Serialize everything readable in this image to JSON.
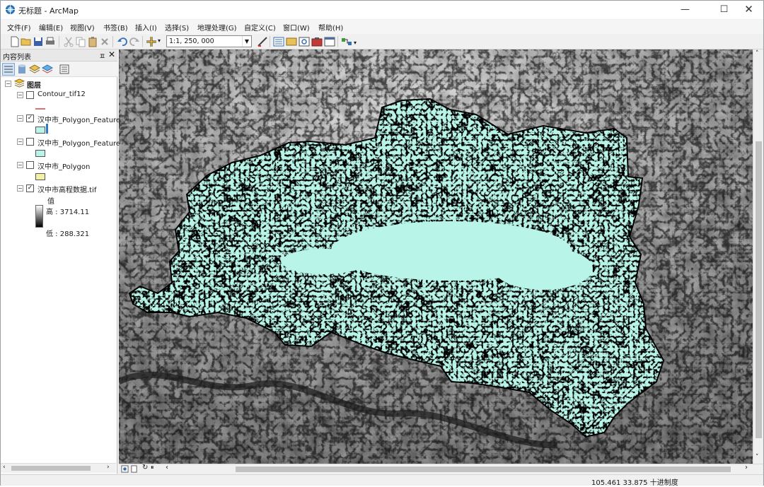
{
  "window": {
    "title": "无标题 - ArcMap",
    "minimize": "—",
    "maximize": "☐",
    "close": "✕"
  },
  "menu": {
    "items": [
      "文件(F)",
      "编辑(E)",
      "视图(V)",
      "书签(B)",
      "插入(I)",
      "选择(S)",
      "地理处理(G)",
      "自定义(C)",
      "窗口(W)",
      "帮助(H)"
    ]
  },
  "toolbar": {
    "scale_value": "1:1, 250, 000"
  },
  "toc": {
    "title": "内容列表",
    "pin": "ㅍ",
    "close": "✕",
    "root_label": "图层",
    "layers": [
      {
        "label": "Contour_tif12",
        "checked": false,
        "symbol": "line",
        "color": "#e07070"
      },
      {
        "label": "汉中市_Polygon_Feature",
        "checked": true,
        "symbol": "fill",
        "color": "#b8f5e8"
      },
      {
        "label": "汉中市_Polygon_Feature",
        "checked": false,
        "symbol": "fill",
        "color": "#b8f5e8"
      },
      {
        "label": "汉中市_Polygon",
        "checked": false,
        "symbol": "fill",
        "color": "#f5f0a8"
      },
      {
        "label": "汉中市高程数据.tif",
        "checked": true,
        "symbol": "raster"
      }
    ],
    "raster_legend": {
      "heading": "值",
      "high": "高 : 3714.11",
      "low": "低 : 288.321"
    }
  },
  "status": {
    "coordinates": "105.461  33.875 十进制度"
  },
  "colors": {
    "polygon_fill": "#b8f5e8",
    "accent": "#2e79c8"
  }
}
